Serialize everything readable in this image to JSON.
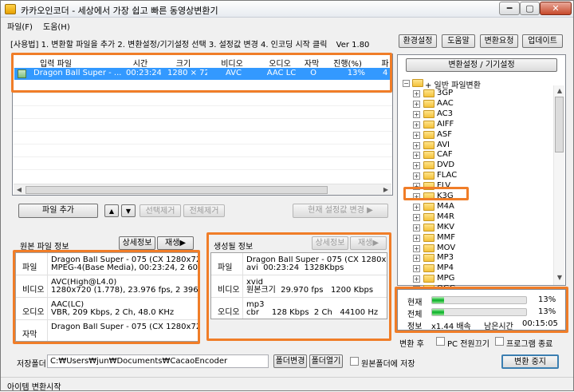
{
  "window": {
    "title": "카카오인코더 - 세상에서 가장 쉽고 빠른 동영상변환기",
    "min_glyph": "━",
    "max_glyph": "▢",
    "close_glyph": "✕"
  },
  "menu": {
    "file": "파일(F)",
    "help": "도움(H)"
  },
  "usage": {
    "text": "[사용법] 1. 변환할 파일을 추가  2. 변환설정/기기설정 선택  3. 설정값 변경  4. 인코딩 시작 클릭",
    "version": "Ver 1.80"
  },
  "top_buttons": {
    "env": "환경설정",
    "help": "도움말",
    "request": "변환요청",
    "update": "업데이트"
  },
  "file_list": {
    "columns": [
      "입력 파일",
      "시간",
      "크기",
      "비디오",
      "오디오",
      "자막",
      "진행(%)",
      "파"
    ],
    "rows": [
      {
        "name": "Dragon Ball Super - ...",
        "time": "00:23:24",
        "size": "1280 × 720",
        "video": "AVC",
        "audio": "AAC LC",
        "subtitle": "O",
        "progress": "13%",
        "extra": "4"
      }
    ]
  },
  "list_controls": {
    "add": "파일 추가",
    "up": "▲",
    "down": "▼",
    "remove_selected": "선택제거",
    "remove_all": "전체제거",
    "apply_current": "현재 설정값 변경 ▶"
  },
  "tree": {
    "title": "변환설정 / 기기설정",
    "root": "+ 일반 파일변환",
    "items": [
      "3GP",
      "AAC",
      "AC3",
      "AIFF",
      "ASF",
      "AVI",
      "CAF",
      "DVD",
      "FLAC",
      "FLV",
      "K3G",
      "M4A",
      "M4R",
      "MKV",
      "MMF",
      "MOV",
      "MP3",
      "MP4",
      "MPG",
      "OGG"
    ],
    "selected": "K3G"
  },
  "source_info": {
    "title": "원본 파일 정보",
    "detail_btn": "상세정보",
    "play_btn": "재생▶",
    "rows": [
      {
        "key": "파일",
        "value": "Dragon Ball Super - 075 (CX 1280x720 x\nMPEG-4(Base Media), 00:23:24, 2 609 K"
      },
      {
        "key": "비디오",
        "value": "AVC(High@L4.0)\n1280x720 (1.778), 23.976 fps, 2 396 Kbps"
      },
      {
        "key": "오디오",
        "value": "AAC(LC)\nVBR, 209 Kbps, 2 Ch, 48.0 KHz"
      },
      {
        "key": "자막",
        "value": "Dragon Ball Super - 075 (CX 1280x72..."
      }
    ]
  },
  "output_info": {
    "title": "생성될 정보",
    "detail_btn": "상세정보",
    "play_btn": "재생▶",
    "rows": [
      {
        "key": "파일",
        "value": "Dragon Ball Super - 075 (CX 1280x720 x\navi  00:23:24  1328Kbps"
      },
      {
        "key": "비디오",
        "value": "xvid\n원본크기  29.970 fps   1200 Kbps"
      },
      {
        "key": "오디오",
        "value": "mp3\ncbr     128 Kbps  2 Ch   44100 Hz"
      }
    ]
  },
  "progress": {
    "current_label": "현재",
    "current_value": "13%",
    "current_fraction": 0.13,
    "total_label": "전체",
    "total_value": "13%",
    "total_fraction": 0.13,
    "info_label": "정보",
    "speed": "x1.44 배속",
    "remaining_label": "남은시간",
    "remaining": "00:15:05"
  },
  "after_convert": {
    "label": "변환 후",
    "pc_off": "PC 전원끄기",
    "program_exit": "프로그램 종료"
  },
  "save": {
    "label": "저장폴더",
    "path": "C:₩Users₩jun₩Documents₩CacaoEncoder",
    "change_btn": "폴더변경",
    "open_btn": "폴더열기",
    "same_folder": "원본폴더에 저장"
  },
  "stop_btn": "변환 중지",
  "status_text": "아이템 변환시작"
}
